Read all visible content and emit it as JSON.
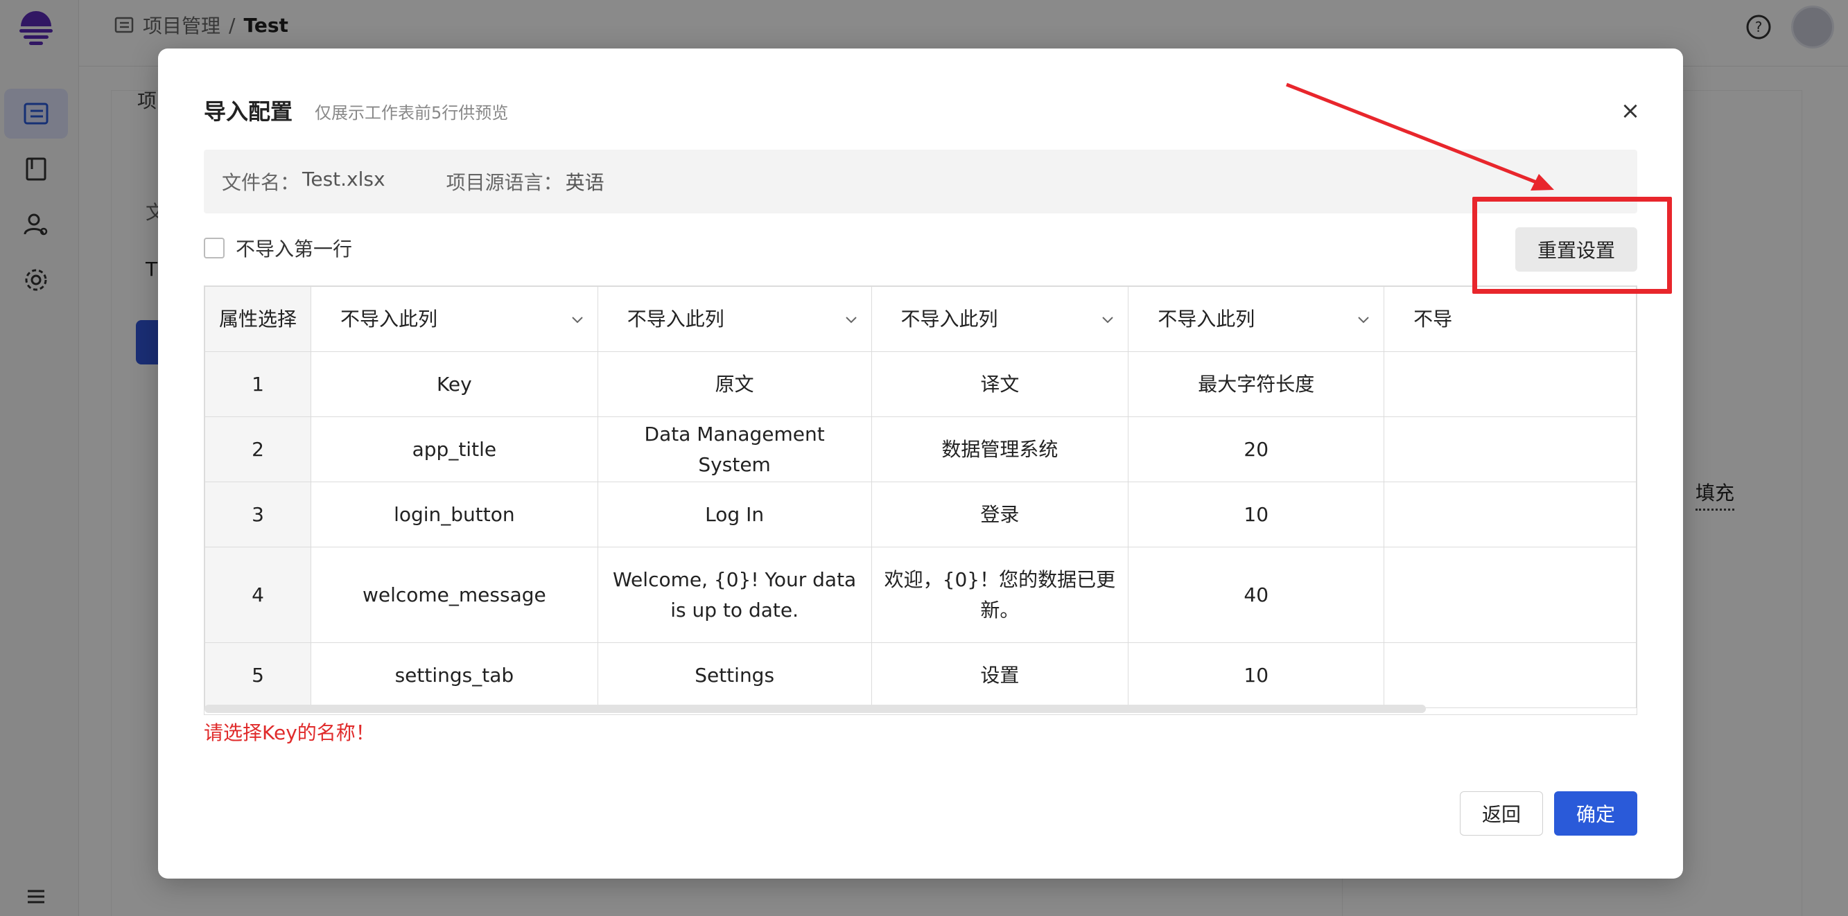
{
  "breadcrumb": {
    "parent": "项目管理",
    "separator": "/",
    "current": "Test"
  },
  "background": {
    "tab_fragment": "项",
    "col_fragment": "文",
    "row_fragment": "T",
    "fill_label": "填充"
  },
  "modal": {
    "title": "导入配置",
    "subtitle": "仅展示工作表前5行供预览",
    "close": "×",
    "file_label": "文件名：",
    "file_value": "Test.xlsx",
    "lang_label": "项目源语言：",
    "lang_value": "英语",
    "skip_first_row": "不导入第一行",
    "reset_button": "重置设置",
    "header_index": "属性选择",
    "column_selects": [
      "不导入此列",
      "不导入此列",
      "不导入此列",
      "不导入此列",
      "不导"
    ],
    "rows": [
      {
        "index": "1",
        "cells": [
          "Key",
          "原文",
          "译文",
          "最大字符长度",
          ""
        ]
      },
      {
        "index": "2",
        "cells": [
          "app_title",
          "Data Management System",
          "数据管理系统",
          "20",
          ""
        ]
      },
      {
        "index": "3",
        "cells": [
          "login_button",
          "Log In",
          "登录",
          "10",
          ""
        ]
      },
      {
        "index": "4",
        "cells": [
          "welcome_message",
          "Welcome, {0}! Your data is up to date.",
          "欢迎，{0}！您的数据已更新。",
          "40",
          ""
        ]
      },
      {
        "index": "5",
        "cells": [
          "settings_tab",
          "Settings",
          "设置",
          "10",
          ""
        ]
      }
    ],
    "error": "请选择Key的名称！",
    "back_button": "返回",
    "confirm_button": "确定"
  },
  "colors": {
    "primary": "#2a5ad9",
    "error": "#e02b2b",
    "annotation": "#e8262c"
  },
  "icons": [
    "logo-icon",
    "project-list-icon",
    "book-icon",
    "user-settings-icon",
    "gear-icon",
    "menu-icon",
    "folder-icon",
    "help-icon",
    "close-icon",
    "chevron-down-icon"
  ]
}
